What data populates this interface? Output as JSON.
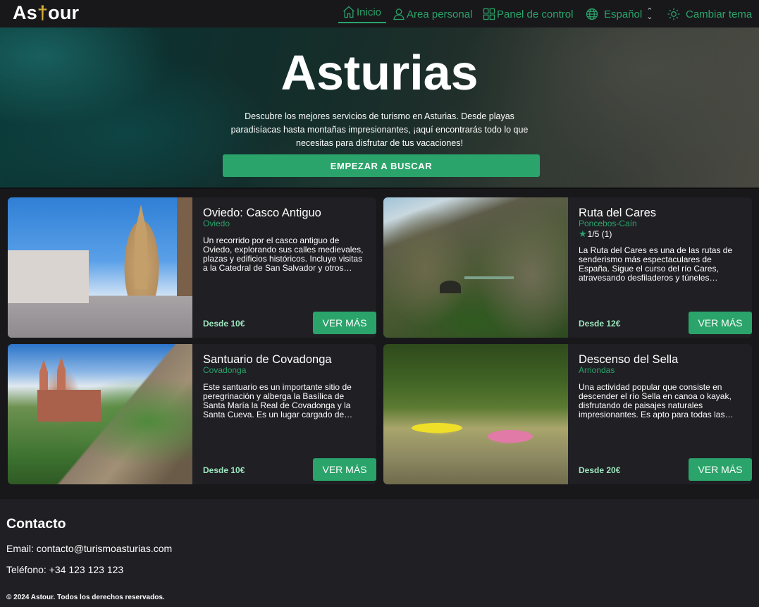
{
  "nav": {
    "logo_pre": "As",
    "logo_cross": "†",
    "logo_post": "our",
    "items": [
      {
        "label": "Inicio",
        "icon": "home-icon",
        "active": true
      },
      {
        "label": "Area personal",
        "icon": "user-icon"
      },
      {
        "label": "Panel de control",
        "icon": "dashboard-icon"
      },
      {
        "label": "Español",
        "icon": "globe-icon"
      },
      {
        "label": "Cambiar tema",
        "icon": "sun-icon"
      }
    ],
    "accent_color": "#2aa46a"
  },
  "hero": {
    "title": "Asturias",
    "description": "Descubre los mejores servicios de turismo en Asturias. Desde playas paradisíacas hasta montañas impresionantes, ¡aquí encontrarás todo lo que necesitas para disfrutar de tus vacaciones!",
    "button": "EMPEZAR A BUSCAR"
  },
  "cards": [
    {
      "title": "Oviedo: Casco Antiguo",
      "location": "Oviedo",
      "description": "Un recorrido por el casco antiguo de Oviedo, explorando sus calles medievales, plazas y edificios históricos. Incluye visitas a la Catedral de San Salvador y otros monumentos.",
      "price": "Desde 10€",
      "button": "VER MÁS"
    },
    {
      "title": "Ruta del Cares",
      "location": "Poncebos-Caín",
      "rating": "1/5 (1)",
      "description": "La Ruta del Cares es una de las rutas de senderismo más espectaculares de España. Sigue el curso del río Cares, atravesando desfiladeros y túneles excavados en la roca.",
      "price": "Desde 12€",
      "button": "VER MÁS"
    },
    {
      "title": "Santuario de Covadonga",
      "location": "Covadonga",
      "description": "Este santuario es un importante sitio de peregrinación y alberga la Basílica de Santa María la Real de Covadonga y la Santa Cueva. Es un lugar cargado de historia.",
      "price": "Desde 10€",
      "button": "VER MÁS"
    },
    {
      "title": "Descenso del Sella",
      "location": "Arriondas",
      "description": "Una actividad popular que consiste en descender el río Sella en canoa o kayak, disfrutando de paisajes naturales impresionantes. Es apto para todas las edades.",
      "price": "Desde 20€",
      "button": "VER MÁS"
    }
  ],
  "footer": {
    "title": "Contacto",
    "email": "Email: contacto@turismoasturias.com",
    "phone": "Teléfono: +34 123 123 123",
    "copyright": "© 2024 Astour. Todos los derechos reservados."
  }
}
